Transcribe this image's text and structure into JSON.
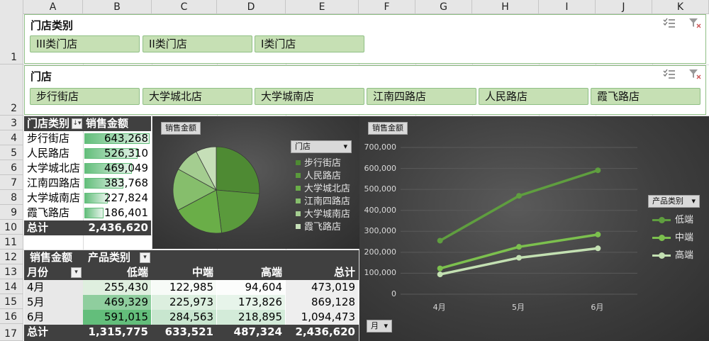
{
  "columns": [
    "A",
    "B",
    "C",
    "D",
    "E",
    "F",
    "G",
    "H",
    "I",
    "J",
    "K"
  ],
  "rows": [
    "1",
    "2",
    "3",
    "4",
    "5",
    "6",
    "7",
    "8",
    "9",
    "10",
    "11",
    "12",
    "13",
    "14",
    "15",
    "16",
    "17"
  ],
  "slicer_type": {
    "title": "门店类别",
    "items": [
      "III类门店",
      "II类门店",
      "I类门店"
    ]
  },
  "slicer_store": {
    "title": "门店",
    "items": [
      "步行街店",
      "大学城北店",
      "大学城南店",
      "江南四路店",
      "人民路店",
      "霞飞路店"
    ]
  },
  "pivot1": {
    "header_store": "门店类别",
    "header_sales": "销售金额",
    "rows": [
      {
        "store": "步行街店",
        "sales": "643,268",
        "value": 643268
      },
      {
        "store": "人民路店",
        "sales": "526,310",
        "value": 526310
      },
      {
        "store": "大学城北店",
        "sales": "469,049",
        "value": 469049
      },
      {
        "store": "江南四路店",
        "sales": "383,768",
        "value": 383768
      },
      {
        "store": "大学城南店",
        "sales": "227,824",
        "value": 227824
      },
      {
        "store": "霞飞路店",
        "sales": "186,401",
        "value": 186401
      }
    ],
    "total_label": "总计",
    "total": "2,436,620"
  },
  "pivot2": {
    "value_label": "销售金额",
    "col_field": "产品类别",
    "row_field": "月份",
    "col_headers": [
      "低端",
      "中端",
      "高端",
      "总计"
    ],
    "rows": [
      {
        "month": "4月",
        "cells": [
          "255,430",
          "122,985",
          "94,604",
          "473,019"
        ]
      },
      {
        "month": "5月",
        "cells": [
          "469,329",
          "225,973",
          "173,826",
          "869,128"
        ]
      },
      {
        "month": "6月",
        "cells": [
          "591,015",
          "284,563",
          "218,895",
          "1,094,473"
        ]
      }
    ],
    "total_label": "总计",
    "totals": [
      "1,315,775",
      "633,521",
      "487,324",
      "2,436,620"
    ]
  },
  "pie_chart": {
    "field_button": "销售金额",
    "legend_field": "门店",
    "legend": [
      "步行街店",
      "人民路店",
      "大学城北店",
      "江南四路店",
      "大学城南店",
      "霞飞路店"
    ],
    "colors": [
      "#4e8a33",
      "#5a9a3c",
      "#6aae48",
      "#86be6c",
      "#a4cd90",
      "#c6dfb8"
    ]
  },
  "line_chart": {
    "field_button": "销售金额",
    "legend_field": "产品类别",
    "axis_field": "月",
    "colors": [
      "#5f9e3f",
      "#7cc04e",
      "#c3e0b2"
    ]
  },
  "chart_data": [
    {
      "type": "pie",
      "title": "",
      "categories": [
        "步行街店",
        "人民路店",
        "大学城北店",
        "江南四路店",
        "大学城南店",
        "霞飞路店"
      ],
      "values": [
        643268,
        526310,
        469049,
        383768,
        227824,
        186401
      ]
    },
    {
      "type": "line",
      "title": "",
      "x": [
        "4月",
        "5月",
        "6月"
      ],
      "series": [
        {
          "name": "低端",
          "values": [
            255430,
            469329,
            591015
          ]
        },
        {
          "name": "中端",
          "values": [
            122985,
            225973,
            284563
          ]
        },
        {
          "name": "高端",
          "values": [
            94604,
            173826,
            218895
          ]
        }
      ],
      "ylim": [
        0,
        700000
      ],
      "yticks": [
        "0",
        "100,000",
        "200,000",
        "300,000",
        "400,000",
        "500,000",
        "600,000",
        "700,000"
      ],
      "grid": true,
      "legend": "right"
    }
  ]
}
